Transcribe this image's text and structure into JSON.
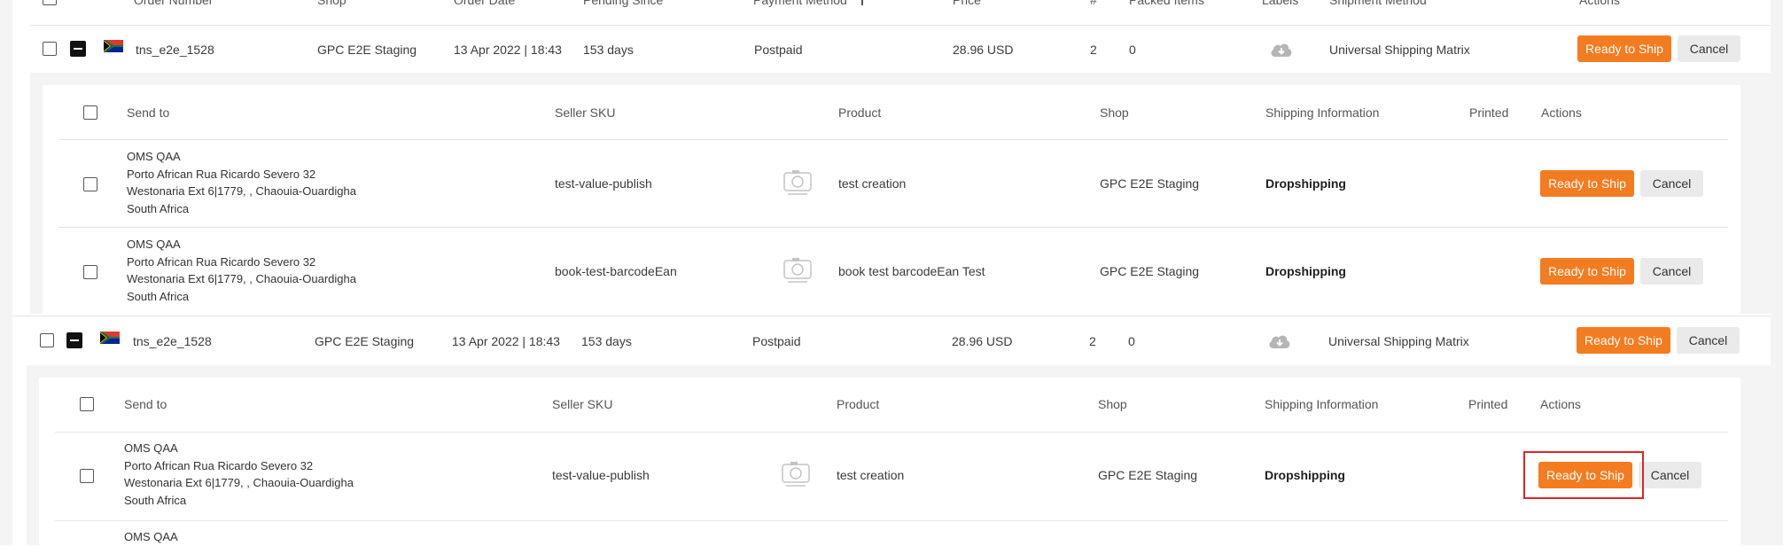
{
  "columns": {
    "order_number": "Order Number",
    "shop": "Shop",
    "order_date": "Order Date",
    "pending_since": "Pending Since",
    "payment_method": "Payment Method",
    "price": "Price",
    "count": "#",
    "packed_items": "Packed Items",
    "labels": "Labels",
    "shipment_method": "Shipment Method",
    "actions": "Actions"
  },
  "orders": [
    {
      "order_number": "tns_e2e_1528",
      "shop": "GPC E2E Staging",
      "order_date": "13 Apr 2022 | 18:43",
      "pending_since": "153 days",
      "payment_method": "Postpaid",
      "price": "28.96 USD",
      "count": "2",
      "packed_items": "0",
      "shipment_method": "Universal Shipping Matrix",
      "ready_label": "Ready to Ship",
      "cancel_label": "Cancel",
      "items_header": {
        "send_to": "Send to",
        "seller_sku": "Seller SKU",
        "product": "Product",
        "shop": "Shop",
        "shipping_information": "Shipping Information",
        "printed": "Printed",
        "actions": "Actions"
      },
      "items": [
        {
          "address": [
            "OMS QAA",
            "Porto African Rua Ricardo Severo 32",
            "Westonaria Ext 6|1779, , Chaouia-Ouardigha",
            "South Africa"
          ],
          "seller_sku": "test-value-publish",
          "product": "test creation",
          "shop": "GPC E2E Staging",
          "shipping": "Dropshipping",
          "ready_label": "Ready to Ship",
          "cancel_label": "Cancel"
        },
        {
          "address": [
            "OMS QAA",
            "Porto African Rua Ricardo Severo 32",
            "Westonaria Ext 6|1779, , Chaouia-Ouardigha",
            "South Africa"
          ],
          "seller_sku": "book-test-barcodeEan",
          "product": "book test barcodeEan Test",
          "shop": "GPC E2E Staging",
          "shipping": "Dropshipping",
          "ready_label": "Ready to Ship",
          "cancel_label": "Cancel"
        }
      ]
    },
    {
      "order_number": "tns_e2e_1528",
      "shop": "GPC E2E Staging",
      "order_date": "13 Apr 2022 | 18:43",
      "pending_since": "153 days",
      "payment_method": "Postpaid",
      "price": "28.96 USD",
      "count": "2",
      "packed_items": "0",
      "shipment_method": "Universal Shipping Matrix",
      "ready_label": "Ready to Ship",
      "cancel_label": "Cancel",
      "items_header": {
        "send_to": "Send to",
        "seller_sku": "Seller SKU",
        "product": "Product",
        "shop": "Shop",
        "shipping_information": "Shipping Information",
        "printed": "Printed",
        "actions": "Actions"
      },
      "items": [
        {
          "address": [
            "OMS QAA",
            "Porto African Rua Ricardo Severo 32",
            "Westonaria Ext 6|1779, , Chaouia-Ouardigha",
            "South Africa"
          ],
          "seller_sku": "test-value-publish",
          "product": "test creation",
          "shop": "GPC E2E Staging",
          "shipping": "Dropshipping",
          "ready_label": "Ready to Ship",
          "cancel_label": "Cancel"
        },
        {
          "address": [
            "OMS QAA"
          ]
        }
      ]
    }
  ],
  "colors": {
    "accent": "#f47c20",
    "highlight": "#e02424"
  }
}
